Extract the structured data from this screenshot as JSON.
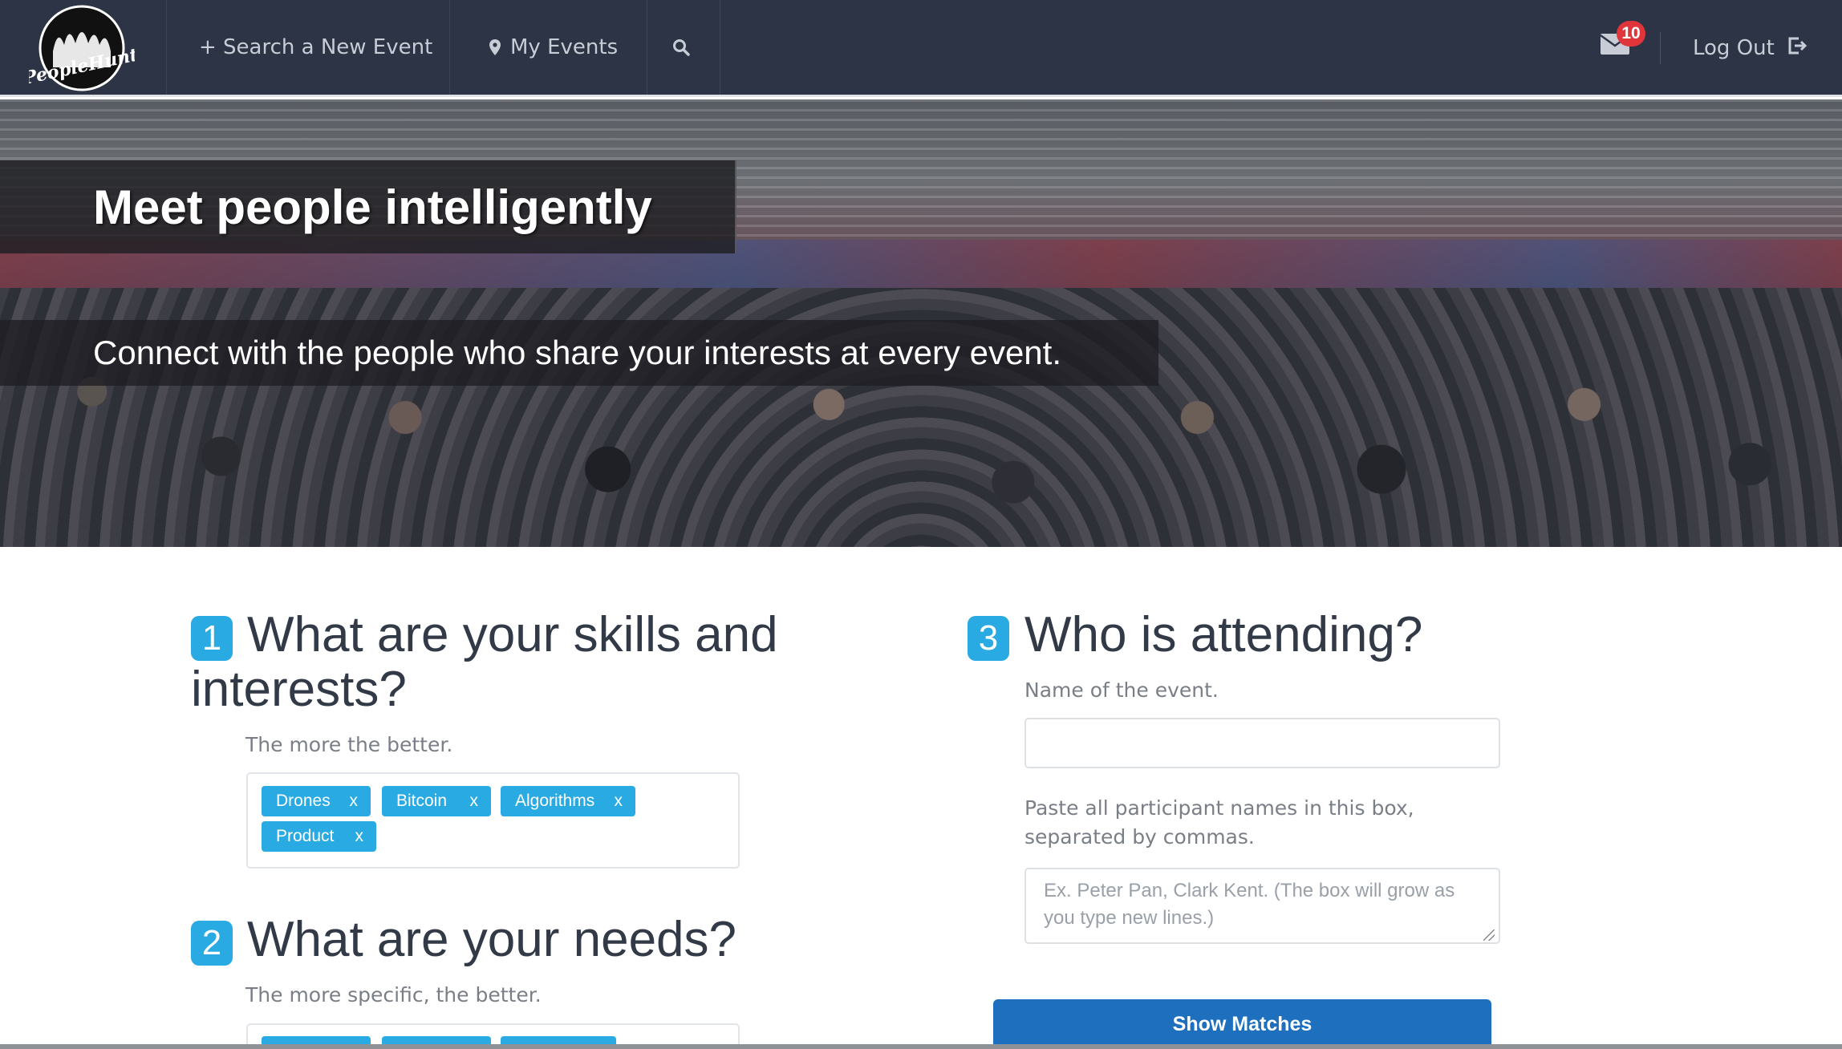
{
  "nav": {
    "logo_text": "PeopleHunt",
    "search_event": "+ Search a New Event",
    "my_events": "My Events",
    "mail_count": "10",
    "logout": "Log Out"
  },
  "hero": {
    "title": "Meet people intelligently",
    "subtitle": "Connect with the people who share your interests at every event."
  },
  "step1": {
    "number": "1",
    "title": "What are your skills and interests?",
    "help": "The more the better.",
    "tags": [
      "Drones",
      "Bitcoin",
      "Algorithms",
      "Product"
    ],
    "remove": "x"
  },
  "step2": {
    "number": "2",
    "title": "What are your needs?",
    "help": "The more specific, the better."
  },
  "step3": {
    "number": "3",
    "title": "Who is attending?",
    "event_label": "Name of the event.",
    "event_value": "",
    "participants_label": "Paste all participant names in this box, separated by commas.",
    "participants_placeholder": "Ex. Peter Pan, Clark Kent. (The box will grow as you type new lines.)",
    "button": "Show Matches"
  },
  "colors": {
    "navbar": "#2c3445",
    "accent": "#2aaae2",
    "button": "#1f6fbf",
    "badge": "#e0353b"
  },
  "icons": [
    "peoplehunt-logo",
    "plus-icon",
    "map-marker-icon",
    "search-icon",
    "envelope-icon",
    "logout-icon"
  ]
}
